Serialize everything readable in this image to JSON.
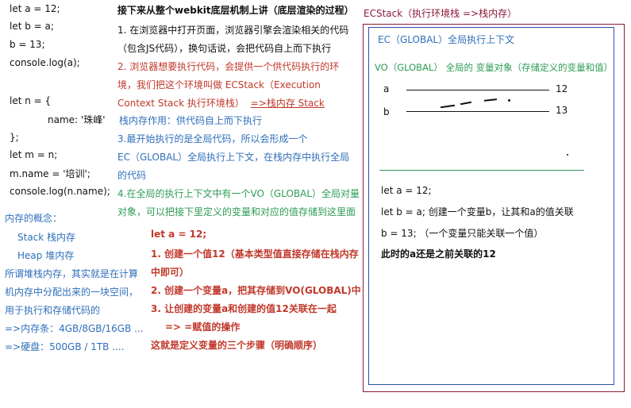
{
  "code_left": {
    "lines": [
      "let a = 12;",
      "let b = a;",
      "b = 13;",
      "console.log(a);",
      "let n = {",
      "name: '珠峰'",
      "};",
      "let m = n;",
      "m.name = '培训';",
      "console.log(n.name);"
    ]
  },
  "memory": {
    "title": "内存的概念：",
    "stack": "Stack  栈内存",
    "heap": "Heap  堆内存",
    "desc1": "所谓堆栈内存，其实就是在计算",
    "desc2": "机内存中分配出来的一块空间，",
    "desc3": "用于执行和存储代码的",
    "ram": "=>内存条：4GB/8GB/16GB ...",
    "disk": "=>硬盘：500GB / 1TB ...."
  },
  "middle": {
    "heading": "接下来从整个webkit底层机制上讲（底层渲染的过程）",
    "p1_line1": "1. 在浏览器中打开页面，浏览器引擎会渲染相关的代码",
    "p1_line2": "（包含JS代码），换句话说，会把代码自上而下执行",
    "p2_line1": "2. 浏览器想要执行代码，会提供一个供代码执行的环",
    "p2_line2": "境，我们把这个环境叫做  ECStack（Execution",
    "p2_line3a": "Context Stack 执行环境栈）",
    "p2_line3b": "=>栈内存 Stack",
    "stack_role": "栈内存作用：供代码自上而下执行",
    "p3_line1": "3.最开始执行的是全局代码，所以会形成一个",
    "p3_line2": "EC（GLOBAL）全局执行上下文，在栈内存中执行全局",
    "p3_line3": "的代码",
    "p4_line1": "4.在全局的执行上下文中有一个VO（GLOBAL）全局对量",
    "p4_line2": "对象，可以把接下里定义的变量和对应的值存储到这里面",
    "steps_title": "let  a  = 12;",
    "step1_line1": "1. 创建一个值12（基本类型值直接存储在栈内存",
    "step1_line2": "中即可）",
    "step2": "2. 创建一个变量a，把其存储到VO(GLOBAL)中",
    "step3": "3. 让创建的变量a和创建的值12关联在一起",
    "assign": "=> =赋值的操作",
    "summary": "这就是定义变量的三个步骤（明确顺序）"
  },
  "ecstack": {
    "title": "ECStack（执行环境栈 =>栈内存）",
    "ec_title": "EC（GLOBAL）全局执行上下文",
    "vo_title": "VO（GLOBAL） 全局的 变量对象（存储定义的变量和值）",
    "var_a": "a",
    "val_a": "12",
    "var_b": "b",
    "val_b": "13",
    "code1": "let a = 12;",
    "code2": "let b = a;  创建一个变量b，让其和a的值关联",
    "code3": "b = 13;  （一个变量只能关联一个值）",
    "note": "此时的a还是之前关联的12"
  },
  "colors": {
    "blue": "#2f6fba",
    "red": "#c0392b",
    "green": "#2e9b57",
    "ecstack_border": "#8b1a3a",
    "ec_border": "#2f4fa8"
  }
}
